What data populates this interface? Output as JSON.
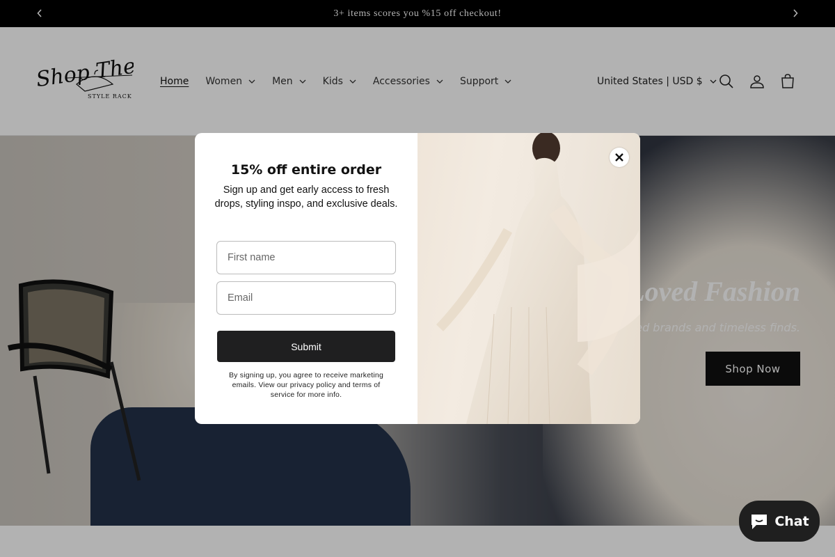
{
  "announcement": {
    "text": "3+ items scores you %15 off checkout!",
    "prev_icon": "chevron-left-icon",
    "next_icon": "chevron-right-icon"
  },
  "header": {
    "logo_text": "Shop The",
    "logo_subtext": "STYLE RACK",
    "nav": [
      {
        "label": "Home"
      },
      {
        "label": "Women"
      },
      {
        "label": "Men"
      },
      {
        "label": "Kids"
      },
      {
        "label": "Accessories"
      },
      {
        "label": "Support"
      }
    ],
    "currency": "United States | USD $",
    "icons": [
      "search-icon",
      "account-icon",
      "cart-icon"
    ]
  },
  "hero": {
    "title": "Loved Fashion",
    "subtitle": "Trusted brands and timeless finds.",
    "button": "Shop Now"
  },
  "popup": {
    "title": "15% off entire order",
    "description": "Sign up and get early access to fresh drops, styling inspo, and exclusive deals.",
    "first_name_placeholder": "First name",
    "email_placeholder": "Email",
    "submit": "Submit",
    "legal": "By signing up, you agree to receive marketing emails. View our privacy policy and terms of service for more info.",
    "close_icon": "close-icon"
  },
  "chat": {
    "label": "Chat",
    "icon": "chat-bubble-icon"
  }
}
